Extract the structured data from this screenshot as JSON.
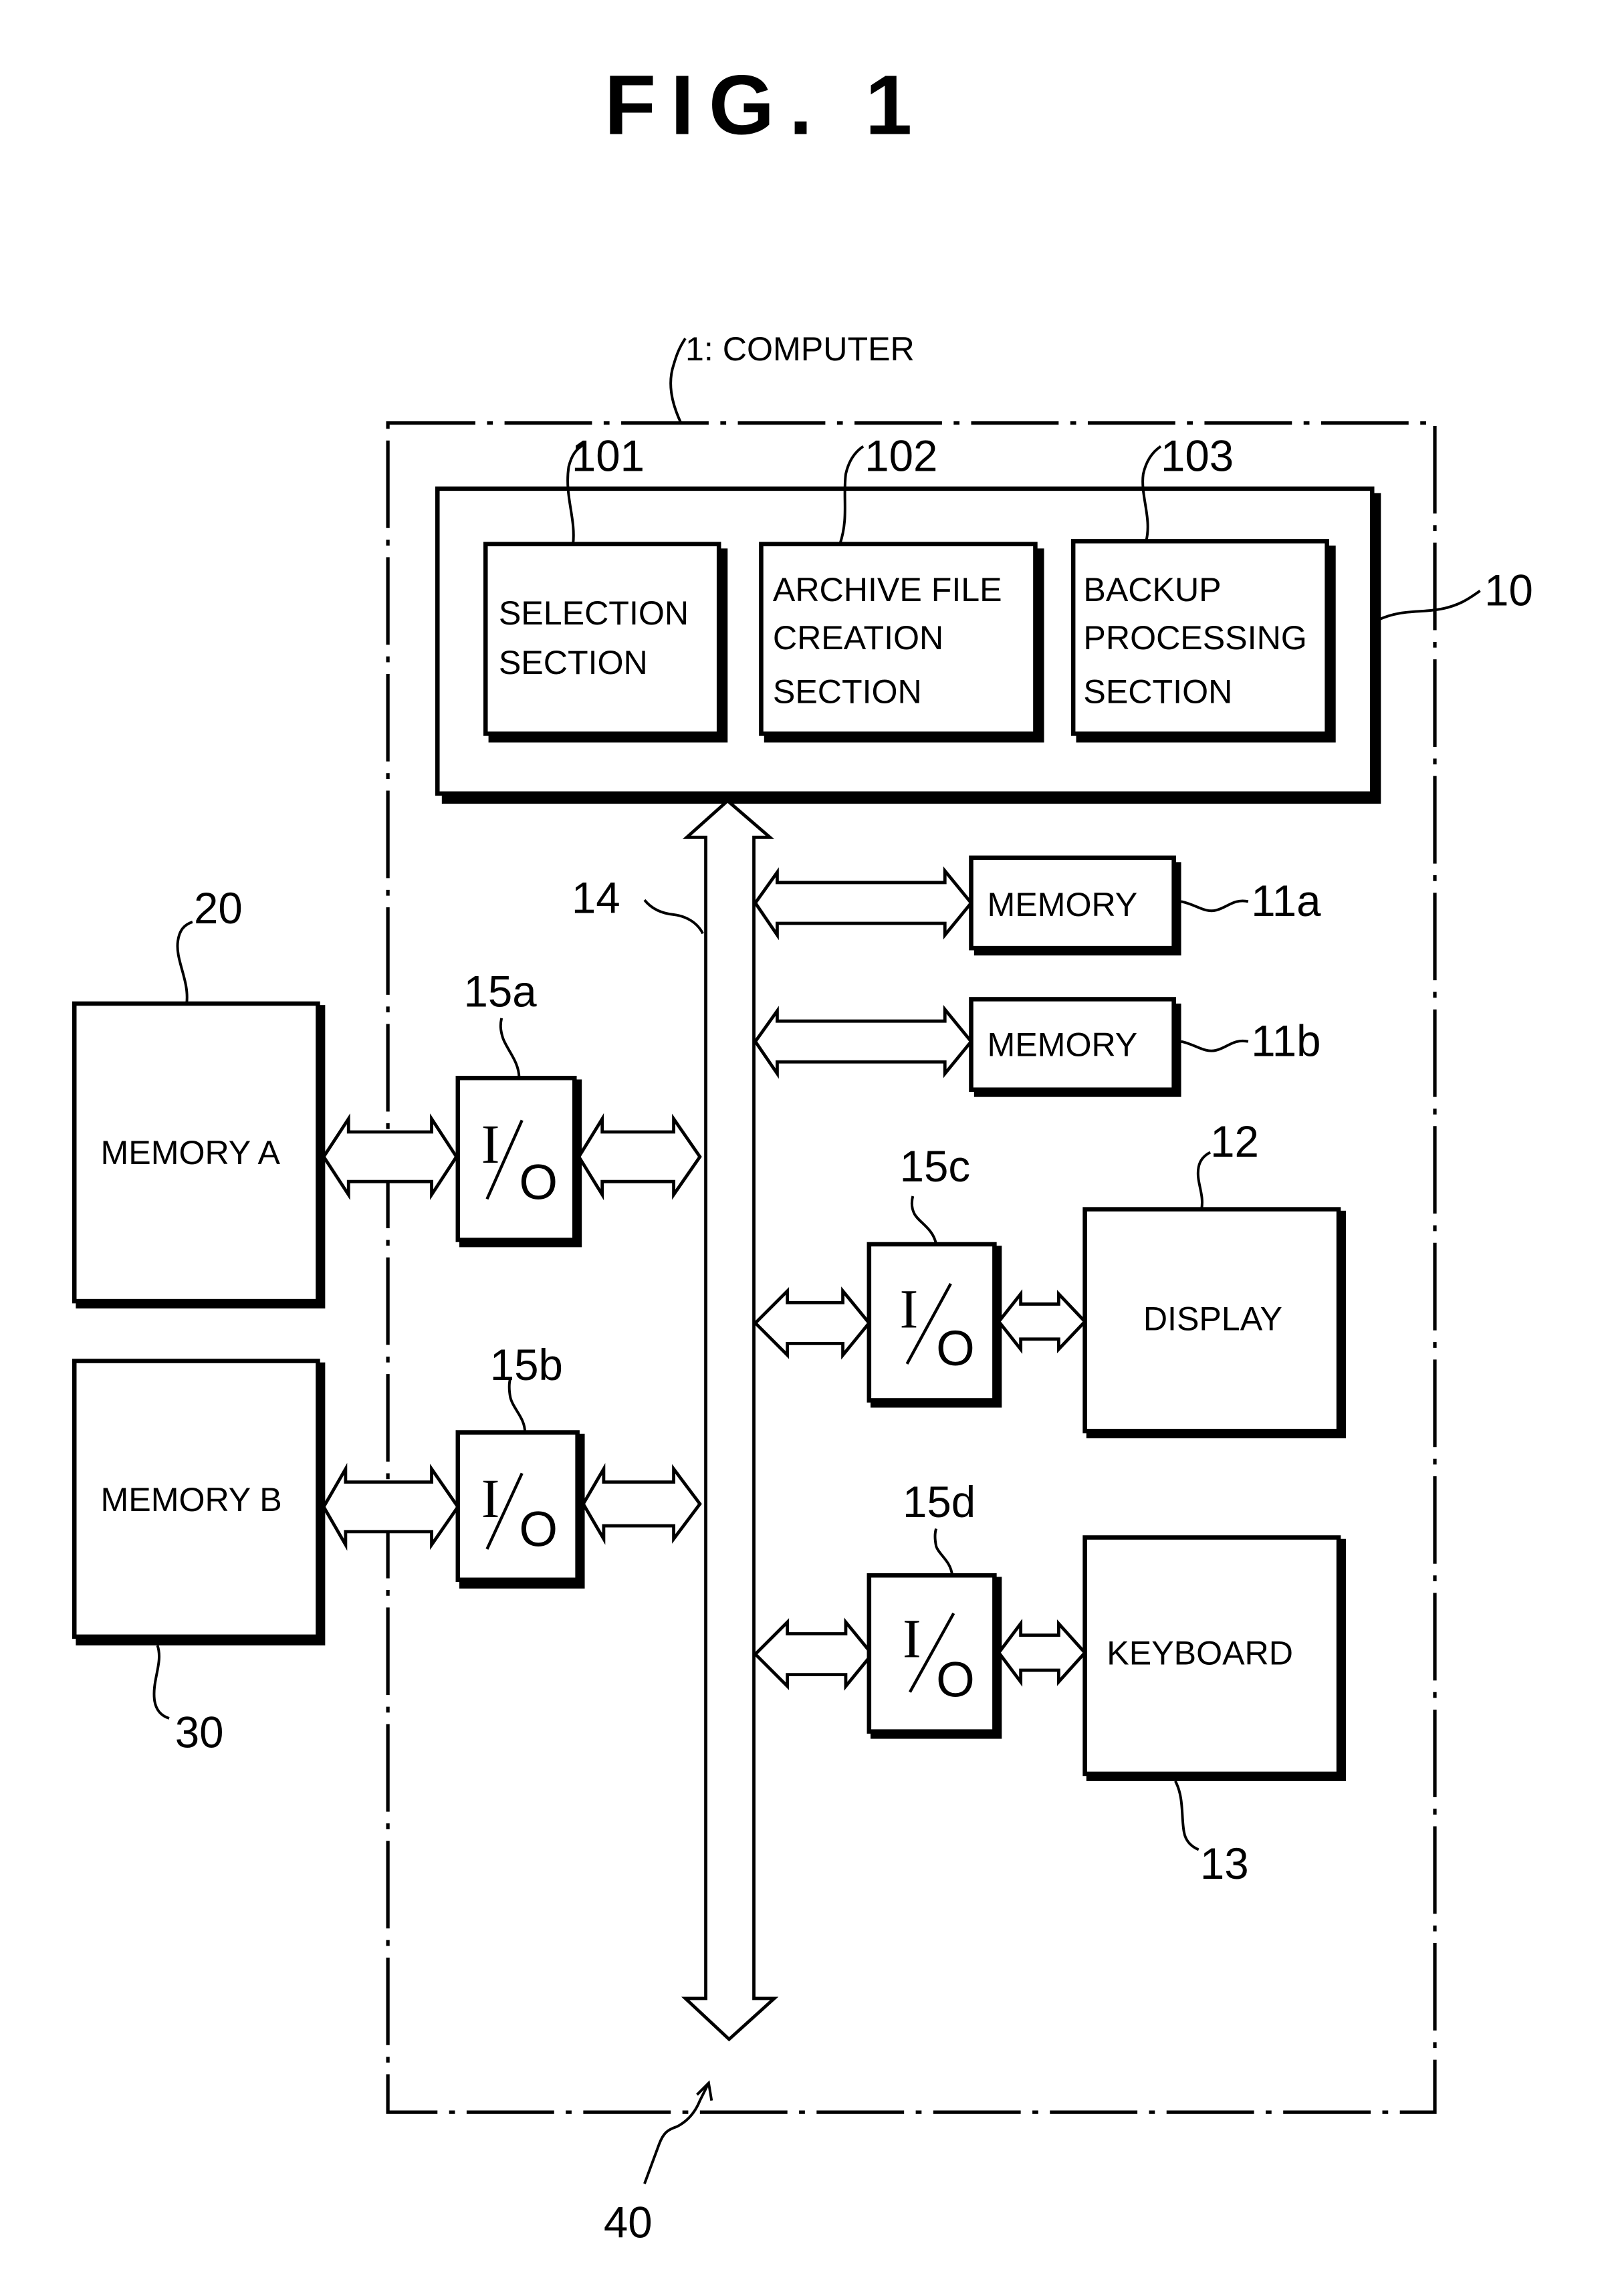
{
  "figure": {
    "title": "FIG. 1"
  },
  "computer": {
    "ref": "1",
    "label": "COMPUTER",
    "ref_label": "1: COMPUTER"
  },
  "processor": {
    "ref": "10",
    "sections": [
      {
        "ref": "101",
        "lines": [
          "SELECTION",
          "SECTION"
        ]
      },
      {
        "ref": "102",
        "lines": [
          "ARCHIVE FILE",
          "CREATION",
          "SECTION"
        ]
      },
      {
        "ref": "103",
        "lines": [
          "BACKUP",
          "PROCESSING",
          "SECTION"
        ]
      }
    ]
  },
  "bus": {
    "ref": "14"
  },
  "memories": [
    {
      "ref": "11a",
      "label": "MEMORY"
    },
    {
      "ref": "11b",
      "label": "MEMORY"
    }
  ],
  "external": [
    {
      "ref": "20",
      "label": "MEMORY  A"
    },
    {
      "ref": "30",
      "label": "MEMORY  B"
    }
  ],
  "io_units": [
    {
      "ref": "15a",
      "top": "I",
      "bottom": "O"
    },
    {
      "ref": "15b",
      "top": "I",
      "bottom": "O"
    },
    {
      "ref": "15c",
      "top": "I",
      "bottom": "O"
    },
    {
      "ref": "15d",
      "top": "I",
      "bottom": "O"
    }
  ],
  "peripherals": [
    {
      "ref": "12",
      "label": "DISPLAY"
    },
    {
      "ref": "13",
      "label": "KEYBOARD"
    }
  ],
  "system": {
    "ref": "40"
  }
}
